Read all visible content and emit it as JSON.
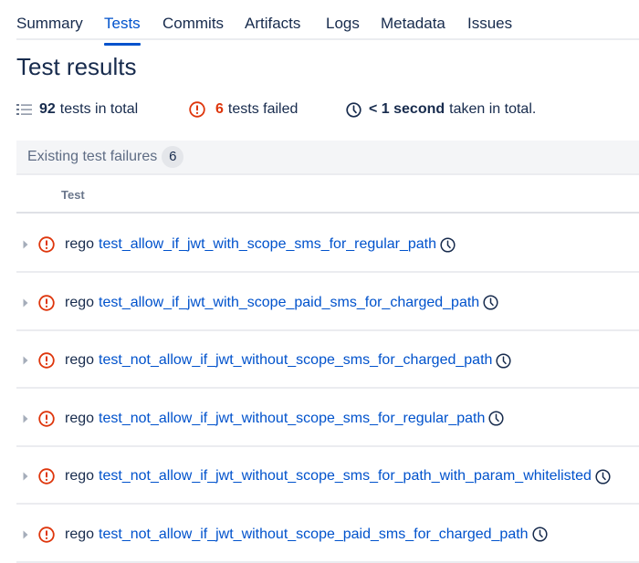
{
  "tabs": [
    {
      "label": "Summary",
      "active": false
    },
    {
      "label": "Tests",
      "active": true
    },
    {
      "label": "Commits",
      "active": false
    },
    {
      "label": "Artifacts",
      "active": false
    },
    {
      "label": "Logs",
      "active": false
    },
    {
      "label": "Metadata",
      "active": false
    },
    {
      "label": "Issues",
      "active": false
    }
  ],
  "page_title": "Test results",
  "stats": {
    "total_count": "92",
    "total_label": "tests in total",
    "failed_count": "6",
    "failed_label": "tests failed",
    "duration_value": "< 1 second",
    "duration_label": "taken in total."
  },
  "group": {
    "title": "Existing test failures",
    "count": "6"
  },
  "table": {
    "column_header": "Test",
    "rows": [
      {
        "suite": "rego",
        "name": "test_allow_if_jwt_with_scope_sms_for_regular_path",
        "status": "failed"
      },
      {
        "suite": "rego",
        "name": "test_allow_if_jwt_with_scope_paid_sms_for_charged_path",
        "status": "failed"
      },
      {
        "suite": "rego",
        "name": "test_not_allow_if_jwt_without_scope_sms_for_charged_path",
        "status": "failed"
      },
      {
        "suite": "rego",
        "name": "test_not_allow_if_jwt_without_scope_sms_for_regular_path",
        "status": "failed"
      },
      {
        "suite": "rego",
        "name": "test_not_allow_if_jwt_without_scope_sms_for_path_with_param_whitelisted",
        "status": "failed"
      },
      {
        "suite": "rego",
        "name": "test_not_allow_if_jwt_without_scope_paid_sms_for_charged_path",
        "status": "failed"
      }
    ]
  },
  "colors": {
    "accent": "#0052cc",
    "error": "#de350b",
    "text": "#172b4d",
    "muted": "#5e6c84"
  },
  "icons": {
    "list": "list-icon",
    "error": "error-circle-icon",
    "clock": "clock-icon",
    "chevron": "chevron-right-icon"
  }
}
